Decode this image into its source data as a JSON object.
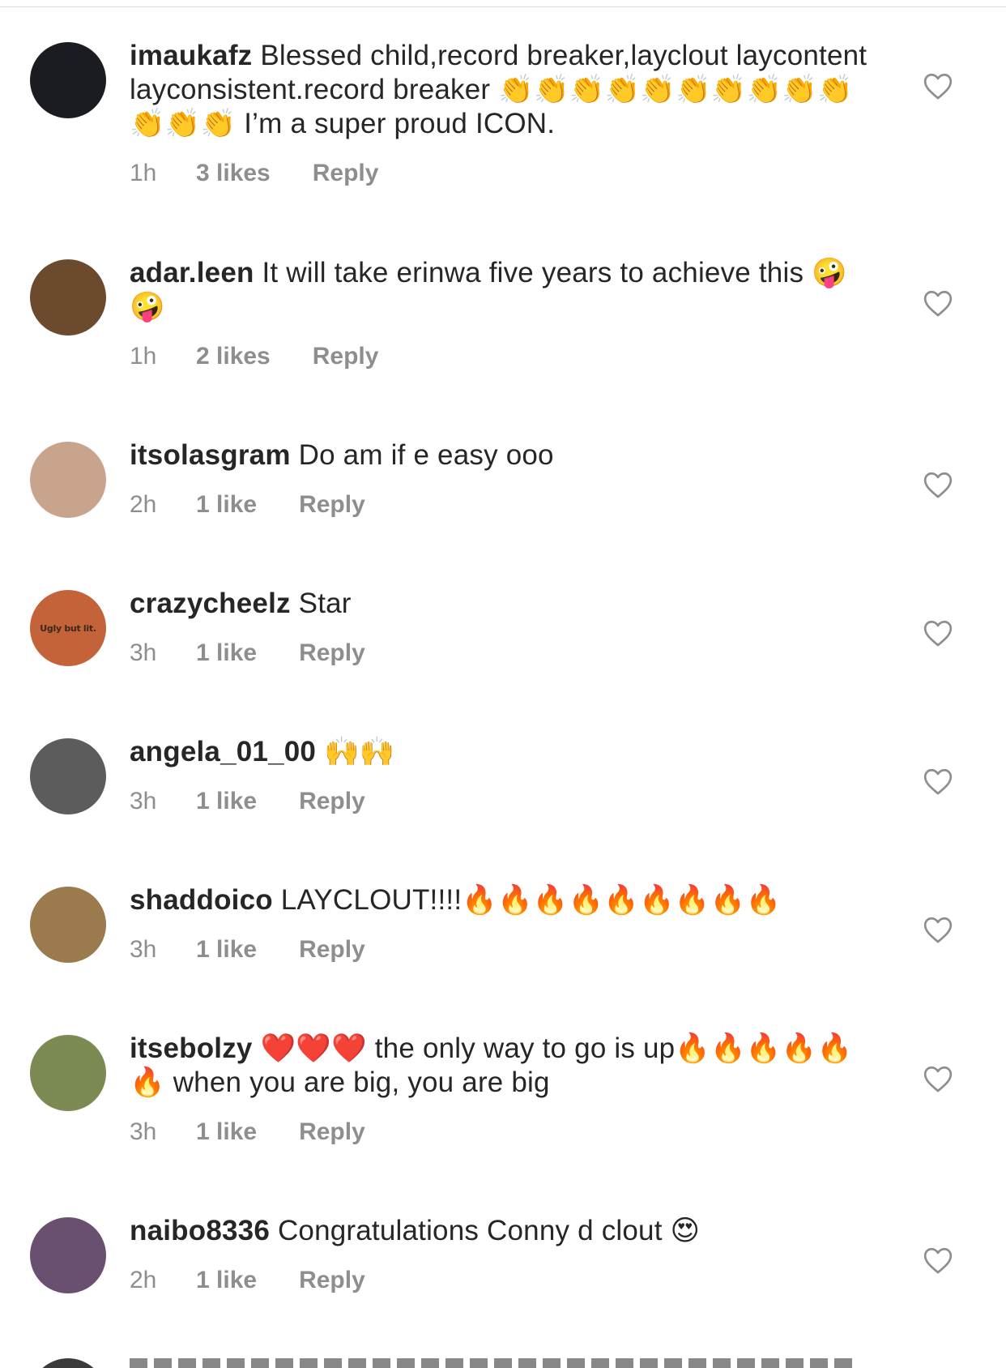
{
  "comments": [
    {
      "username": "imaukafz",
      "text": "Blessed child,record breaker,layclout laycontent layconsistent.record breaker 👏👏👏👏👏👏👏👏👏👏👏👏👏 I’m a super proud ICON.",
      "time": "1h",
      "likes": "3 likes",
      "reply": "Reply",
      "avatar_color": "#1b1b22"
    },
    {
      "username": "adar.leen",
      "text": "It will take erinwa five years to achieve this 🤪🤪",
      "time": "1h",
      "likes": "2 likes",
      "reply": "Reply",
      "avatar_color": "#6b4a2e"
    },
    {
      "username": "itsolasgram",
      "text": "Do am if e easy ooo",
      "time": "2h",
      "likes": "1 like",
      "reply": "Reply",
      "avatar_color": "#c9a48d"
    },
    {
      "username": "crazycheelz",
      "text": "Star",
      "time": "3h",
      "likes": "1 like",
      "reply": "Reply",
      "avatar_color": "#c4623a",
      "avatar_text": "Ugly but lit."
    },
    {
      "username": "angela_01_00",
      "text": "🙌🙌",
      "time": "3h",
      "likes": "1 like",
      "reply": "Reply",
      "avatar_color": "#5c5c5c"
    },
    {
      "username": "shaddoico",
      "text": "LAYCLOUT!!!!🔥🔥🔥🔥🔥🔥🔥🔥🔥",
      "time": "3h",
      "likes": "1 like",
      "reply": "Reply",
      "avatar_color": "#9b7a4e"
    },
    {
      "username": "itsebolzy",
      "text": "❤️❤️❤️ the only way to go is up🔥🔥🔥🔥🔥🔥 when you are big, you are big",
      "time": "3h",
      "likes": "1 like",
      "reply": "Reply",
      "avatar_color": "#7a8a52"
    },
    {
      "username": "naibo8336",
      "text": "Congratulations Conny d clout 😍",
      "time": "2h",
      "likes": "1 like",
      "reply": "Reply",
      "avatar_color": "#6a5070"
    }
  ],
  "icons": {
    "like": "heart-outline-icon"
  },
  "colors": {
    "text": "#262626",
    "meta": "#8e8e8e",
    "divider": "#dbdbdb"
  }
}
